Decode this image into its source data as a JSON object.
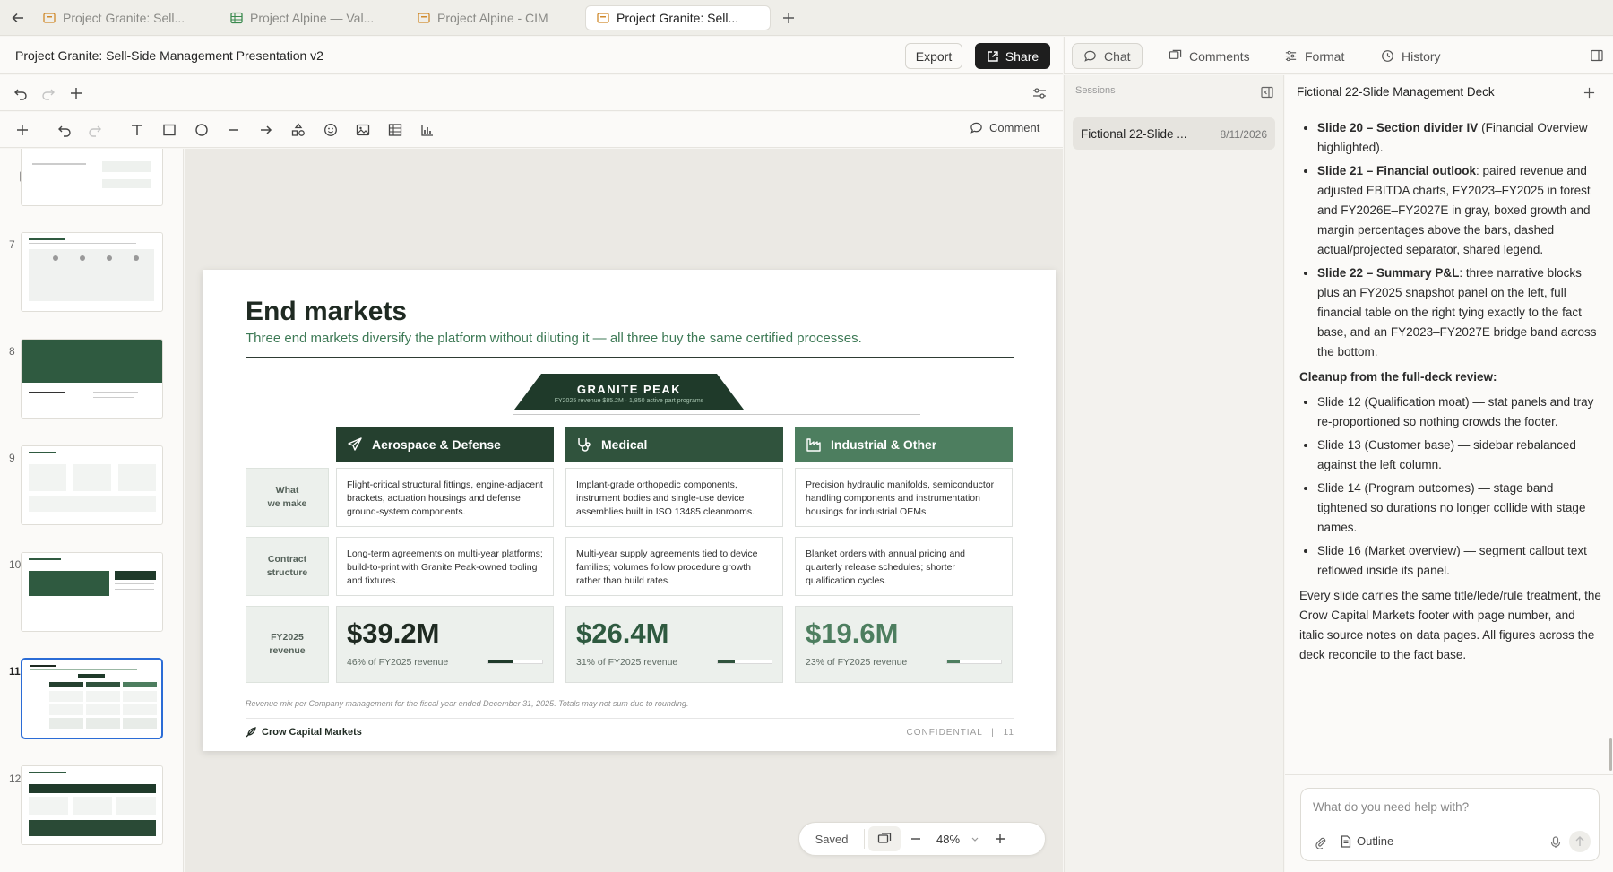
{
  "tabs": [
    {
      "label": "Project Granite: Sell...",
      "icon": "presentation-icon",
      "active": false
    },
    {
      "label": "Project Alpine — Val...",
      "icon": "spreadsheet-icon",
      "active": false
    },
    {
      "label": "Project Alpine - CIM",
      "icon": "presentation-icon",
      "active": false
    },
    {
      "label": "Project Granite: Sell...",
      "icon": "presentation-icon",
      "active": true
    }
  ],
  "doc": {
    "title": "Project Granite: Sell-Side Management Presentation v2",
    "export_label": "Export",
    "share_label": "Share"
  },
  "toolbar": {
    "comment_label": "Comment"
  },
  "thumbnails": [
    {
      "number": "7"
    },
    {
      "number": "8"
    },
    {
      "number": "9"
    },
    {
      "number": "10"
    },
    {
      "number": "11"
    },
    {
      "number": "12"
    }
  ],
  "slide": {
    "title": "End markets",
    "lede": "Three end markets diversify the platform without diluting it — all three buy the same certified processes.",
    "banner_title": "GRANITE PEAK",
    "banner_sub": "FY2025 revenue $85.2M  ·  1,850 active part programs",
    "row_labels": [
      "What\nwe make",
      "Contract\nstructure",
      "FY2025\nrevenue"
    ],
    "columns": [
      {
        "name": "Aerospace & Defense",
        "color": "#25402f",
        "icon": "airplane-icon",
        "what": "Flight-critical structural fittings, engine-adjacent brackets, actuation housings and defense ground-system components.",
        "contract": "Long-term agreements on multi-year platforms; build-to-print with Granite Peak-owned tooling and fixtures.",
        "revenue": "$39.2M",
        "share_text": "46% of FY2025 revenue",
        "share": 0.46,
        "value_color": "#1f2a22"
      },
      {
        "name": "Medical",
        "color": "#30533d",
        "icon": "stethoscope-icon",
        "what": "Implant-grade orthopedic components, instrument bodies and single-use device assemblies built in ISO 13485 cleanrooms.",
        "contract": "Multi-year supply agreements tied to device families; volumes follow procedure growth rather than build rates.",
        "revenue": "$26.4M",
        "share_text": "31% of FY2025 revenue",
        "share": 0.31,
        "value_color": "#2f5a40"
      },
      {
        "name": "Industrial & Other",
        "color": "#4d7e5f",
        "icon": "factory-icon",
        "what": "Precision hydraulic manifolds, semiconductor handling components and instrumentation housings for industrial OEMs.",
        "contract": "Blanket orders with annual pricing and quarterly release schedules; shorter qualification cycles.",
        "revenue": "$19.6M",
        "share_text": "23% of FY2025 revenue",
        "share": 0.23,
        "value_color": "#4d7e5f"
      }
    ],
    "source": "Revenue mix per Company management for the fiscal year ended December 31, 2025. Totals may not sum due to rounding.",
    "brand": "Crow Capital Markets",
    "confidential": "CONFIDENTIAL",
    "page_sep": "|",
    "page": "11"
  },
  "zoom": {
    "saved_label": "Saved",
    "level": "48%"
  },
  "right_panel": {
    "tabs": {
      "chat": "Chat",
      "comments": "Comments",
      "format": "Format",
      "history": "History"
    },
    "sessions_label": "Sessions",
    "session_item": {
      "name": "Fictional 22-Slide ...",
      "date": "8/11/2026"
    },
    "chat_title": "Fictional 22-Slide Management Deck",
    "bullets_a": [
      {
        "bold": "Slide 20 – Section divider IV",
        "rest": " (Financial Overview highlighted)."
      },
      {
        "bold": "Slide 21 – Financial outlook",
        "rest": ": paired revenue and adjusted EBITDA charts, FY2023–FY2025 in forest and FY2026E–FY2027E in gray, boxed growth and margin percentages above the bars, dashed actual/projected separator, shared legend."
      },
      {
        "bold": "Slide 22 – Summary P&L",
        "rest": ": three narrative blocks plus an FY2025 snapshot panel on the left, full financial table on the right tying exactly to the fact base, and an FY2023–FY2027E bridge band across the bottom."
      }
    ],
    "cleanup_heading": "Cleanup from the full-deck review:",
    "bullets_b": [
      "Slide 12 (Qualification moat) — stat panels and tray re-proportioned so nothing crowds the footer.",
      "Slide 13 (Customer base) — sidebar rebalanced against the left column.",
      "Slide 14 (Program outcomes) — stage band tightened so durations no longer collide with stage names.",
      "Slide 16 (Market overview) — segment callout text reflowed inside its panel."
    ],
    "closing": "Every slide carries the same title/lede/rule treatment, the Crow Capital Markets footer with page number, and italic source notes on data pages. All figures across the deck reconcile to the fact base.",
    "input_placeholder": "What do you need help with?",
    "outline_label": "Outline"
  }
}
